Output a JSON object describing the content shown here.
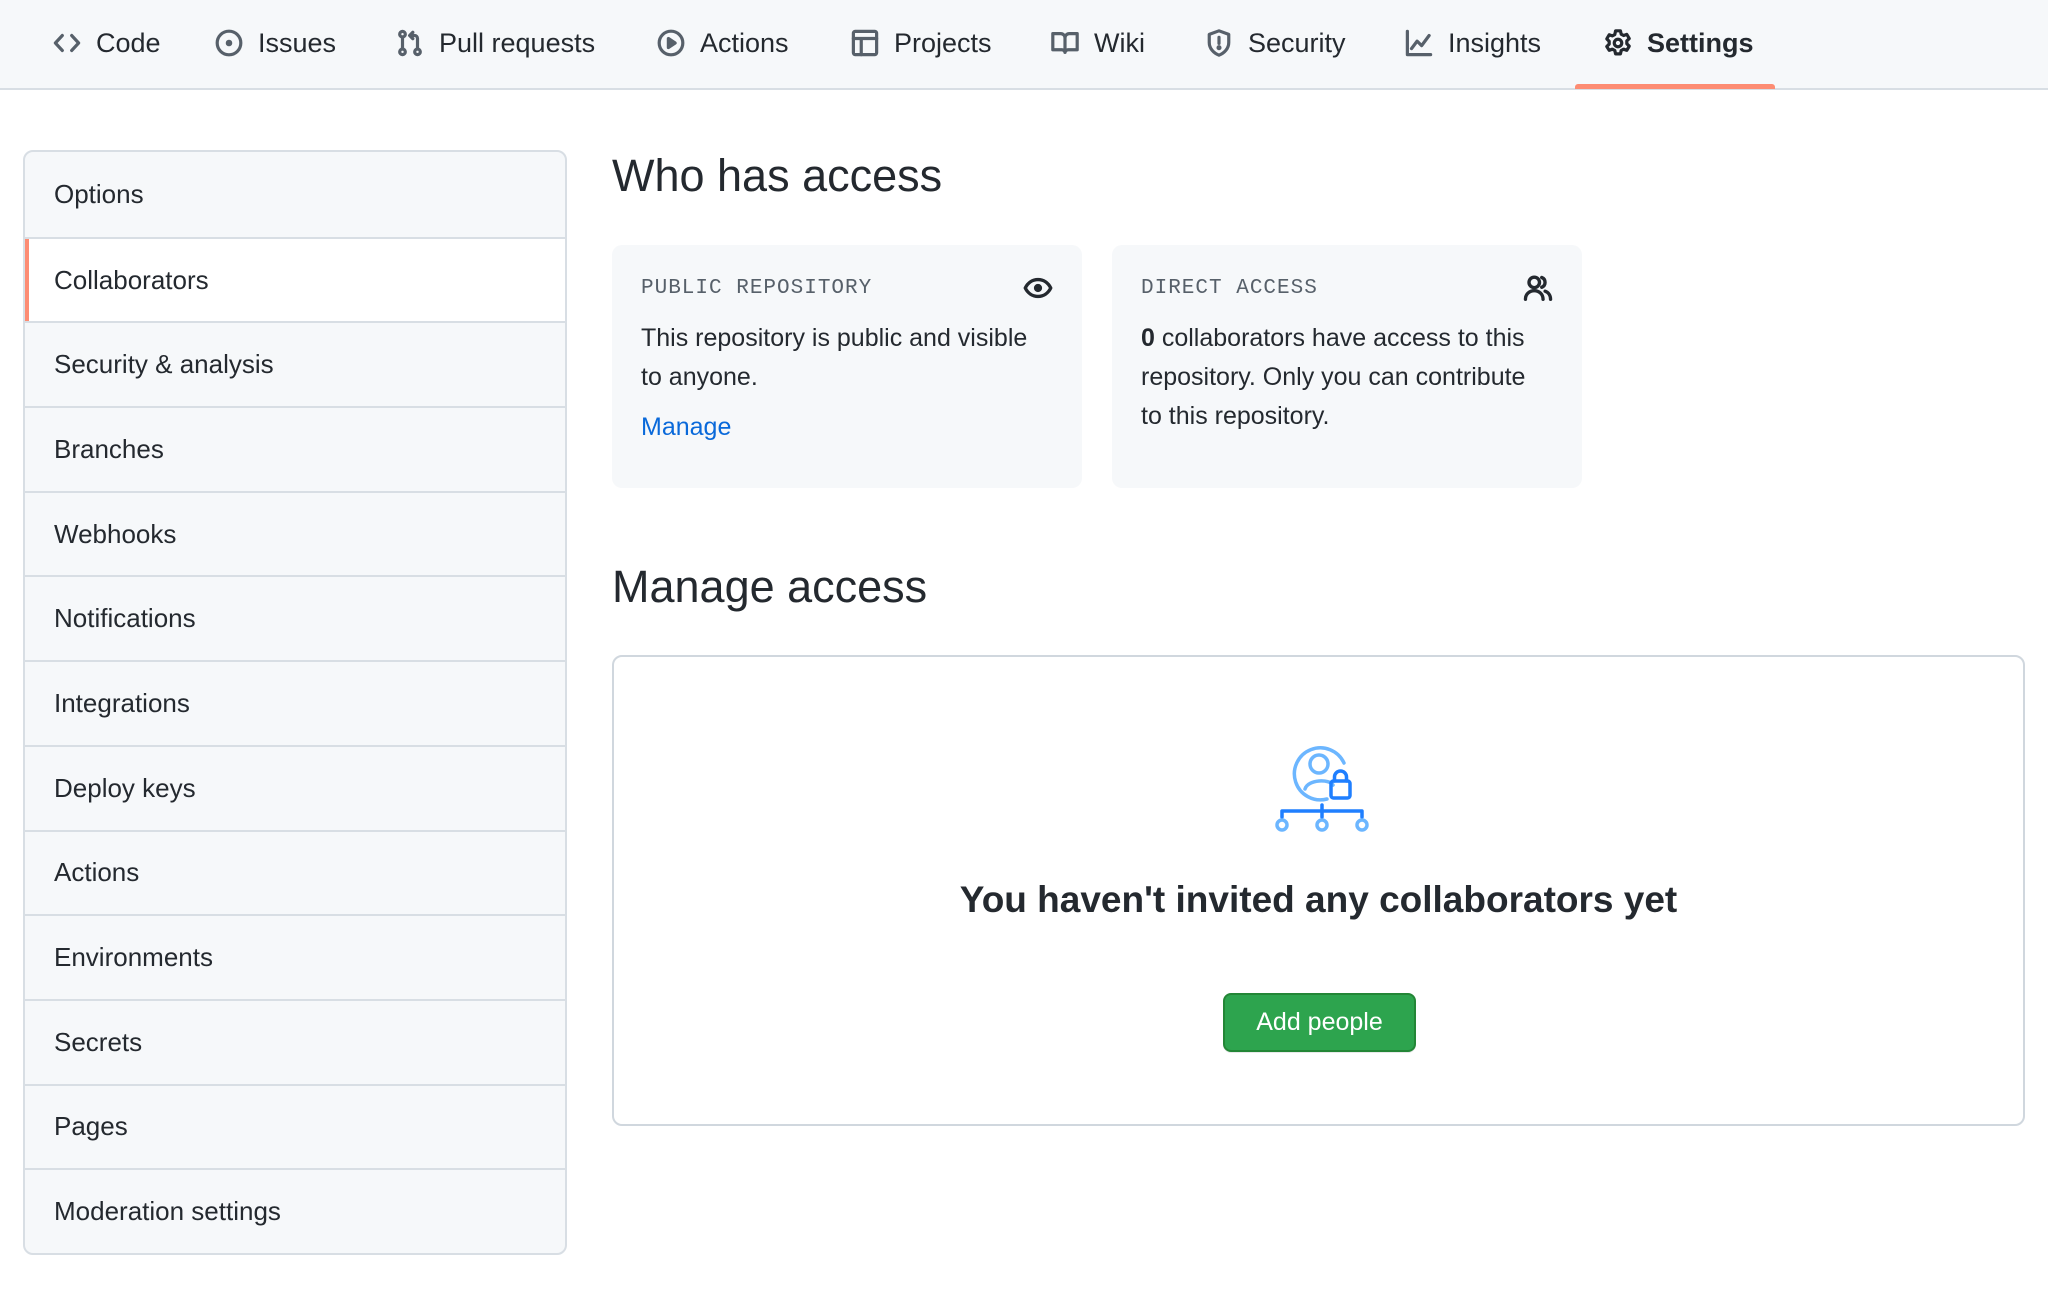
{
  "nav": {
    "tabs": [
      {
        "label": "Code",
        "icon": "code-icon"
      },
      {
        "label": "Issues",
        "icon": "issue-icon"
      },
      {
        "label": "Pull requests",
        "icon": "pull-request-icon"
      },
      {
        "label": "Actions",
        "icon": "play-icon"
      },
      {
        "label": "Projects",
        "icon": "table-icon"
      },
      {
        "label": "Wiki",
        "icon": "book-icon"
      },
      {
        "label": "Security",
        "icon": "shield-icon"
      },
      {
        "label": "Insights",
        "icon": "graph-icon"
      },
      {
        "label": "Settings",
        "icon": "gear-icon",
        "active": true
      }
    ],
    "accent_color": "#fd8c73"
  },
  "sidebar": {
    "items": [
      {
        "label": "Options"
      },
      {
        "label": "Collaborators",
        "active": true
      },
      {
        "label": "Security & analysis"
      },
      {
        "label": "Branches"
      },
      {
        "label": "Webhooks"
      },
      {
        "label": "Notifications"
      },
      {
        "label": "Integrations"
      },
      {
        "label": "Deploy keys"
      },
      {
        "label": "Actions"
      },
      {
        "label": "Environments"
      },
      {
        "label": "Secrets"
      },
      {
        "label": "Pages"
      },
      {
        "label": "Moderation settings"
      }
    ]
  },
  "who_has_access": {
    "title": "Who has access",
    "public_card": {
      "label": "PUBLIC REPOSITORY",
      "icon": "eye-icon",
      "text": "This repository is public and visible to anyone.",
      "link": "Manage"
    },
    "direct_card": {
      "label": "DIRECT ACCESS",
      "icon": "people-icon",
      "count": "0",
      "text": " collaborators have access to this repository. Only you can contribute to this repository."
    }
  },
  "manage_access": {
    "title": "Manage access",
    "empty_icon": "collaborators-lock-illustration",
    "empty_title": "You haven't invited any collaborators yet",
    "add_button": "Add people",
    "button_color": "#2da44e"
  }
}
